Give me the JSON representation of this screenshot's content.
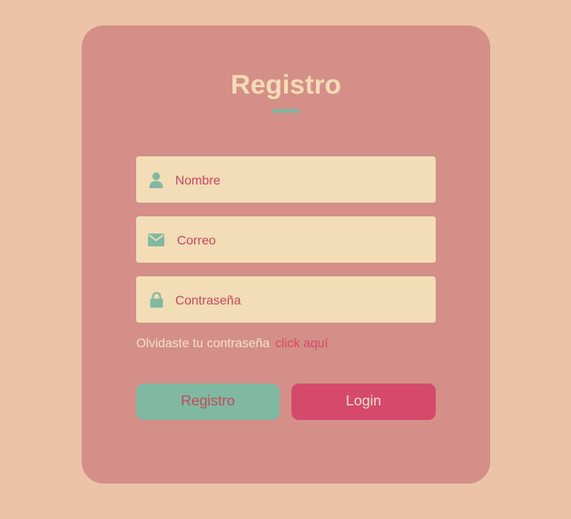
{
  "form": {
    "title": "Registro",
    "fields": [
      {
        "icon": "user-icon",
        "placeholder": "Nombre"
      },
      {
        "icon": "envelope-icon",
        "placeholder": "Correo"
      },
      {
        "icon": "lock-icon",
        "placeholder": "Contraseña"
      }
    ],
    "forgot_text": "Olvidaste tu contraseña",
    "forgot_link": "click aquí",
    "register_button": "Registro",
    "login_button": "Login"
  },
  "colors": {
    "page_background": "#ecc3a8",
    "card_background": "#d38f88",
    "field_background": "#f2ddb6",
    "accent_green": "#7fb9a1",
    "accent_pink": "#d5496b",
    "title_color": "#f7dbb5"
  }
}
